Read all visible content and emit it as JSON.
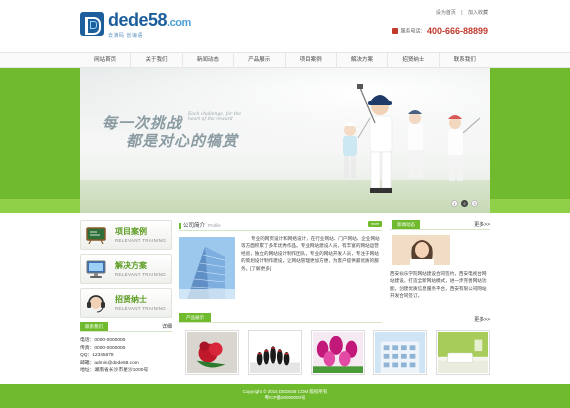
{
  "header": {
    "logo_text": "dede58",
    "logo_suffix": ".com",
    "logo_slogan": "去演码 创诲语",
    "top_links": [
      "设为首页",
      "|",
      "加入收藏"
    ],
    "hotline_label": "服务电话：",
    "hotline_number": "400-666-88899"
  },
  "nav": {
    "items": [
      "网站首页",
      "关于我们",
      "新闻动态",
      "产品展示",
      "项目案例",
      "解决方案",
      "招贤纳士",
      "联系我们"
    ]
  },
  "banner": {
    "slogan_line1": "每一次挑战",
    "slogan_line2": "都是对心的犒赏",
    "slogan_en": "Each challenge, for the heart of the reward",
    "dots": [
      "1",
      "2",
      "3"
    ],
    "active_dot": 2
  },
  "services": [
    {
      "title": "项目案例",
      "subtitle": "RELEVANT TRAINING",
      "icon": "chalkboard-icon"
    },
    {
      "title": "解决方案",
      "subtitle": "RELEVANT TRAINING",
      "icon": "monitor-icon"
    },
    {
      "title": "招贤纳士",
      "subtitle": "RELEVANT TRAINING",
      "icon": "headset-icon"
    }
  ],
  "contact": {
    "tag": "联系我们",
    "more": "详细",
    "lines": [
      "电话：0000-0000000",
      "传真：0000-0000000",
      "QQ：12345678",
      "邮箱：admin@dede58.com",
      "地址：湖南省长沙市星沙1000号"
    ]
  },
  "about": {
    "title": "公司简介",
    "title_en": "Profile",
    "more": "more",
    "text": "专业的网页设计和网络设计，在行业网站、门户网站、企业网站等方面积累了多年优秀作品。专业网站建设人员，有丰富的网站运营经验，独立的网站设计制作团队，专业的网站开发人员，专注于网站的策划设计制作建设，让网站管理更加方便，为客户提供最优质的服务。[了解更多]"
  },
  "products_section": {
    "tag": "产品展示"
  },
  "news": {
    "tag": "新闻动态",
    "more": "更多>>",
    "text": "西安俞乐学院网站建设合同签约，西安电视台网站建设，打造全新网站模式，进一步完善网站功能，创建优质信息服务平台，西安有限公司网站开发合同签订。",
    "more_bottom": "更多>>"
  },
  "products": [
    {
      "name": "product-1"
    },
    {
      "name": "product-2"
    },
    {
      "name": "product-3"
    },
    {
      "name": "product-4"
    },
    {
      "name": "product-5"
    }
  ],
  "footer": {
    "line1": "Copyright © 2015 DEDE58 COM 版权所有",
    "line2": "粤ICP备00000000号"
  },
  "colors": {
    "brand_green": "#6fbb2d",
    "logo_blue": "#1d5f9c",
    "hotline_red": "#c0392b"
  }
}
